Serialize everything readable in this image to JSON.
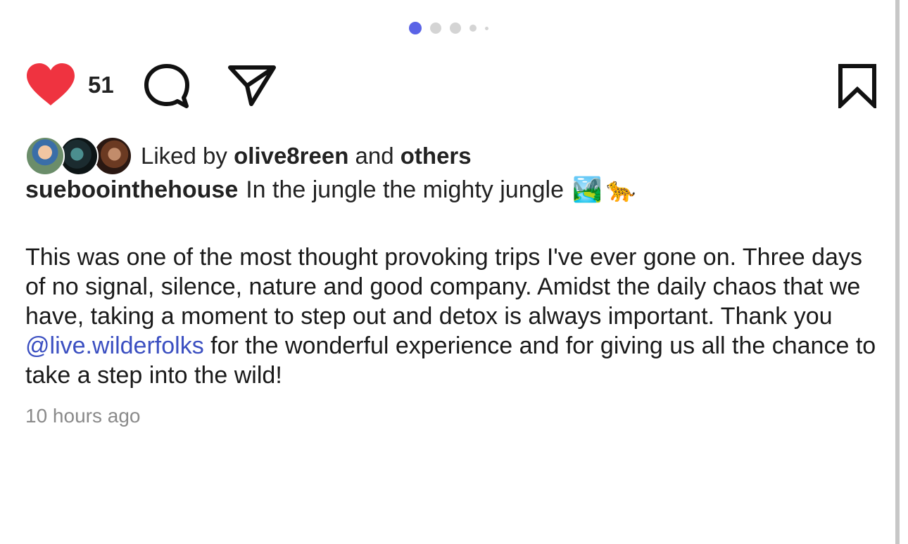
{
  "carousel": {
    "slide_count": 5,
    "active_index": 0,
    "active_color": "#5a63e6",
    "inactive_color": "#d4d4d4"
  },
  "actions": {
    "like_icon": "heart-icon",
    "like_color": "#ef3340",
    "like_count": "51",
    "comment_icon": "comment-bubble-icon",
    "share_icon": "paper-plane-icon",
    "bookmark_icon": "bookmark-icon"
  },
  "likes": {
    "prefix": "Liked by ",
    "user": "olive8reen",
    "conjunction": " and ",
    "others": "others"
  },
  "post": {
    "username": "sueboointhehouse",
    "caption_first_line": "In the jungle the mighty jungle",
    "caption_emojis": [
      "🏞️",
      "🐆"
    ],
    "body_before_mention": "This was one of the most thought provoking trips I've ever gone on. Three days of no signal, silence, nature and good company. Amidst the daily chaos that we have, taking a moment to step out and detox is always important. Thank you ",
    "mention": "@live.wilderfolks",
    "mention_color": "#3b4fc1",
    "body_after_mention": " for the wonderful experience and for giving us all the chance to take a step into the wild!",
    "timestamp": "10 hours ago"
  }
}
